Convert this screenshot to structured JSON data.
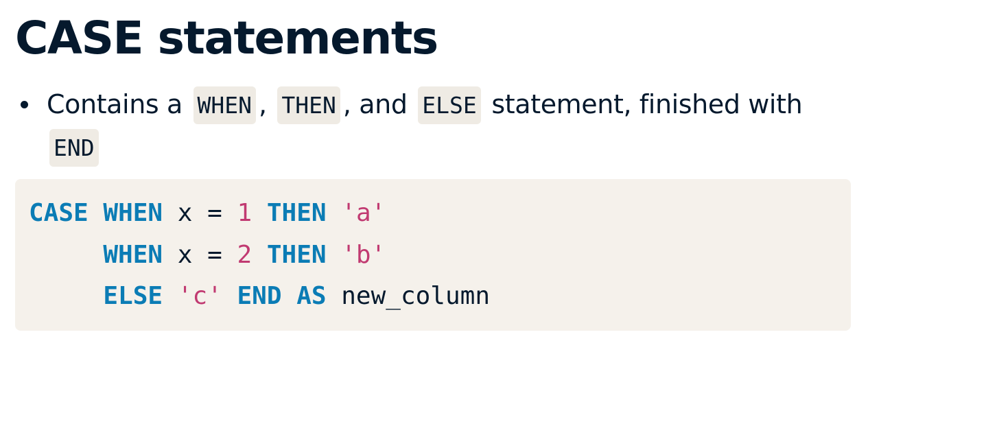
{
  "slide": {
    "title": "CASE statements"
  },
  "bullet": {
    "text_1": "Contains a",
    "code_1": "WHEN",
    "text_2": ",",
    "code_2": "THEN",
    "text_3": ", and",
    "code_3": "ELSE",
    "text_4": "statement, finished with",
    "code_4": "END"
  },
  "code": {
    "line_1": {
      "kw_1": "CASE",
      "kw_2": "WHEN",
      "plain_1": "x =",
      "num_1": "1",
      "kw_3": "THEN",
      "str_1": "'a'"
    },
    "line_2": {
      "indent": "     ",
      "kw_1": "WHEN",
      "plain_1": "x =",
      "num_1": "2",
      "kw_2": "THEN",
      "str_1": "'b'"
    },
    "line_3": {
      "indent": "     ",
      "kw_1": "ELSE",
      "str_1": "'c'",
      "kw_2": "END",
      "kw_3": "AS",
      "plain_1": "new_column"
    }
  },
  "colors": {
    "text": "#05192d",
    "keyword": "#0b7cb5",
    "literal": "#c13a71",
    "code_background": "#f5f1eb",
    "inline_code_background": "#efebe4"
  }
}
